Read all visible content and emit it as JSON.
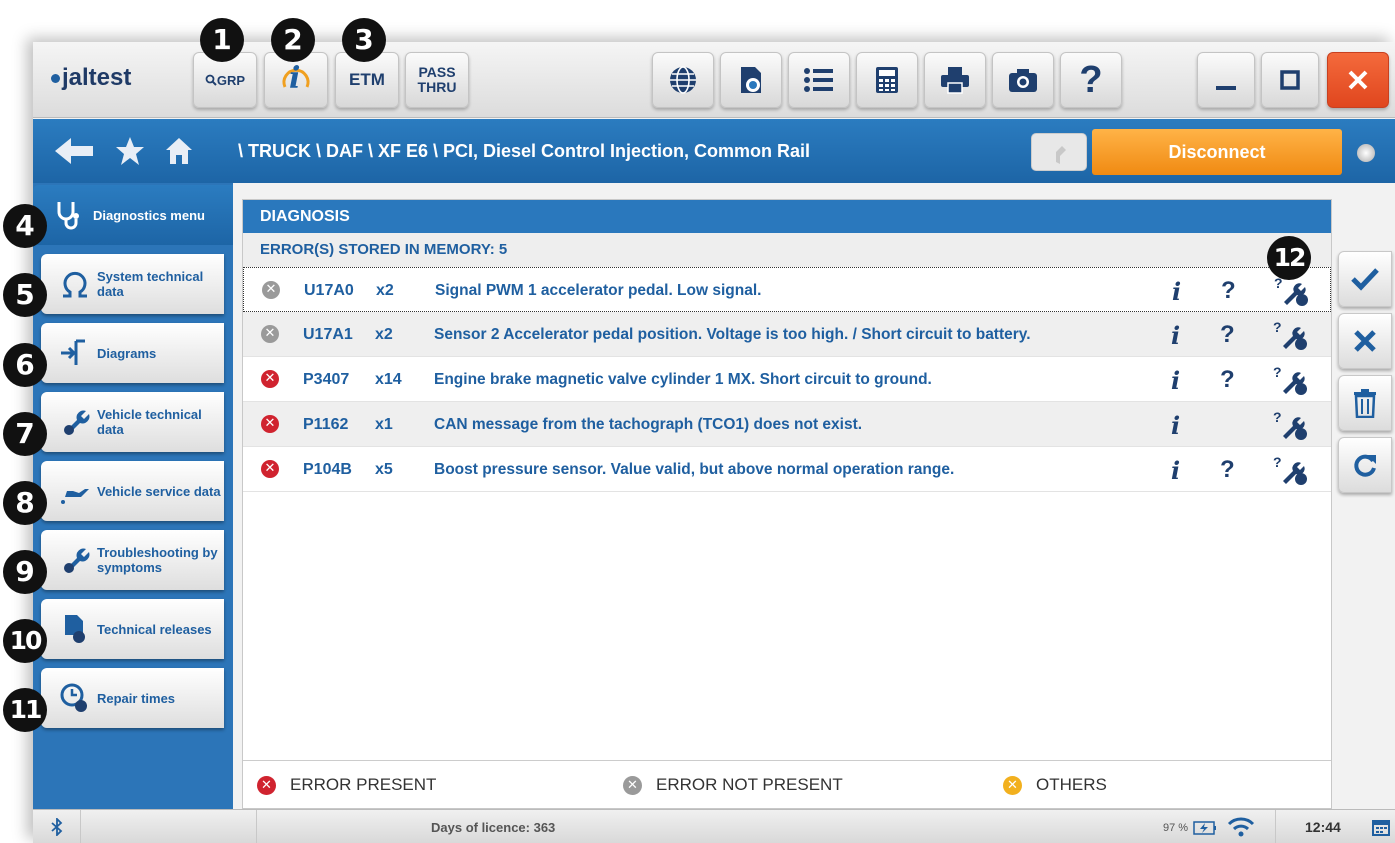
{
  "badges": [
    "1",
    "2",
    "3",
    "4",
    "5",
    "6",
    "7",
    "8",
    "9",
    "10",
    "11",
    "12"
  ],
  "toolbar": {
    "logo": "jaltest",
    "grp_label": "GRP",
    "info_label": "i",
    "etm_label": "ETM",
    "passthru_line1": "PASS",
    "passthru_line2": "THRU",
    "help_label": "?",
    "icons": [
      "globe-icon",
      "document-eye-icon",
      "list-icon",
      "calculator-icon",
      "printer-icon",
      "camera-icon",
      "help-icon",
      "minimize-icon",
      "maximize-icon",
      "close-icon"
    ]
  },
  "navbar": {
    "path": "\\ TRUCK \\ DAF \\ XF E6 \\ PCI, Diesel Control Injection, Common Rail",
    "disconnect_label": "Disconnect"
  },
  "sidebar": {
    "items": [
      {
        "label": "Diagnostics menu",
        "icon": "stethoscope-icon",
        "active": true
      },
      {
        "label": "System technical data",
        "icon": "ohm-icon"
      },
      {
        "label": "Diagrams",
        "icon": "diagram-icon"
      },
      {
        "label": "Vehicle technical data",
        "icon": "wrench-globe-icon"
      },
      {
        "label": "Vehicle service data",
        "icon": "oil-can-icon"
      },
      {
        "label": "Troubleshooting by symptoms",
        "icon": "wrench-globe-icon"
      },
      {
        "label": "Technical releases",
        "icon": "document-globe-icon"
      },
      {
        "label": "Repair times",
        "icon": "clock-globe-icon"
      }
    ]
  },
  "main": {
    "title": "DIAGNOSIS",
    "subtitle": "ERROR(S) STORED IN MEMORY: 5",
    "rows": [
      {
        "status": "not-present",
        "code": "U17A0",
        "count": "x2",
        "desc": "Signal PWM 1 accelerator pedal. Low signal.",
        "has_help": true
      },
      {
        "status": "not-present",
        "code": "U17A1",
        "count": "x2",
        "desc": "Sensor 2 Accelerator pedal position. Voltage is too high. / Short circuit to battery.",
        "has_help": true
      },
      {
        "status": "present",
        "code": "P3407",
        "count": "x14",
        "desc": "Engine brake magnetic valve cylinder 1 MX. Short circuit to ground.",
        "has_help": true
      },
      {
        "status": "present",
        "code": "P1162",
        "count": "x1",
        "desc": "CAN message from the tachograph (TCO1) does not exist.",
        "has_help": false
      },
      {
        "status": "present",
        "code": "P104B",
        "count": "x5",
        "desc": "Boost pressure sensor. Value valid, but above normal operation range.",
        "has_help": true
      }
    ],
    "info_glyph": "i",
    "help_glyph": "?",
    "legend": {
      "present": "ERROR PRESENT",
      "not_present": "ERROR NOT PRESENT",
      "others": "OTHERS"
    }
  },
  "actions": [
    "check-icon",
    "cross-icon",
    "trash-icon",
    "refresh-icon"
  ],
  "status": {
    "licence": "Days of licence: 363",
    "battery": "97 %",
    "time": "12:44"
  },
  "colors": {
    "brand_blue": "#2a78bd",
    "present_red": "#d0232f",
    "not_present_gray": "#9a9a9a",
    "others_yellow": "#f2b01e",
    "disconnect_orange": "#f7a030",
    "close_red": "#e84b2c"
  }
}
